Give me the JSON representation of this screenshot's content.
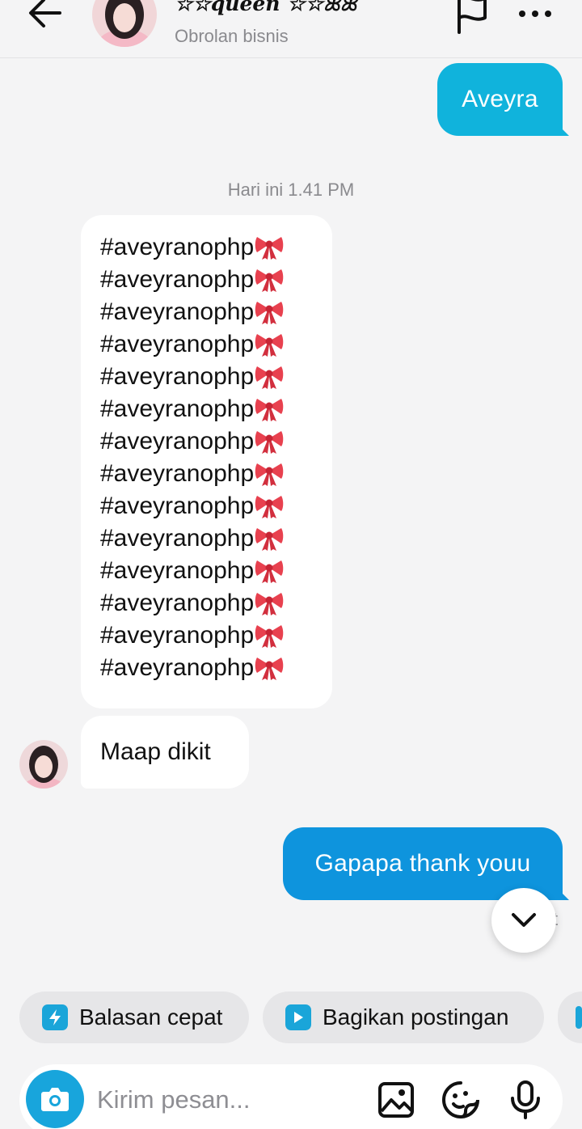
{
  "header": {
    "title": "☆☆queen ☆☆ꕤꕤ",
    "subtitle": "Obrolan bisnis",
    "back_icon": "arrow-left-icon",
    "flag_icon": "flag-icon",
    "more_icon": "more-horizontal-icon"
  },
  "messages": {
    "out_1": "Aveyra",
    "timestamp": "Hari ini 1.41 PM",
    "hashtag_lines": [
      "#aveyranophp",
      "#aveyranophp",
      "#aveyranophp",
      "#aveyranophp",
      "#aveyranophp",
      "#aveyranophp",
      "#aveyranophp",
      "#aveyranophp",
      "#aveyranophp",
      "#aveyranophp",
      "#aveyranophp",
      "#aveyranophp",
      "#aveyranophp",
      "#aveyranophp"
    ],
    "in_2": "Maap dikit",
    "out_2": "Gapapa thank youu",
    "read_hint": "t"
  },
  "quick_actions": {
    "quick_reply": "Balasan cepat",
    "share_post": "Bagikan postingan"
  },
  "composer": {
    "placeholder": "Kirim pesan..."
  },
  "colors": {
    "accent": "#10b3dc",
    "bubble_blue": "#0e94dd",
    "background": "#f4f4f5"
  }
}
